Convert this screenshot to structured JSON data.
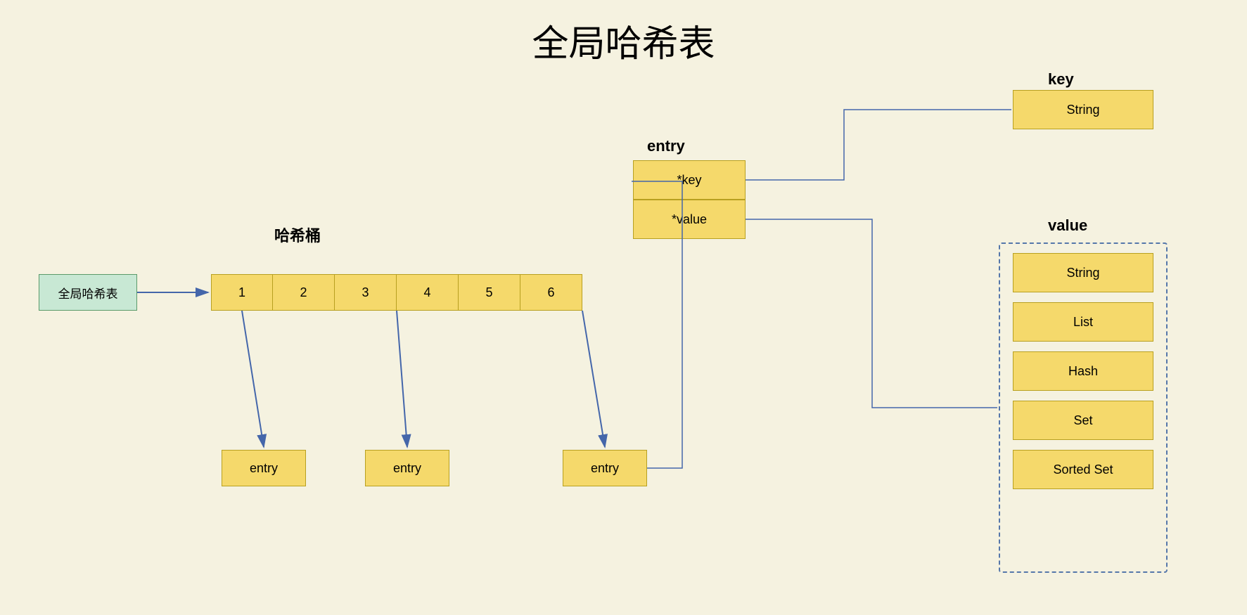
{
  "title": "全局哈希表",
  "global_hashtable_label": "全局哈希表",
  "hashtable_bucket_label": "哈希桶",
  "bucket_cells": [
    "1",
    "2",
    "3",
    "4",
    "5",
    "6"
  ],
  "entry_label": "entry",
  "entry_key_field": "*key",
  "entry_value_field": "*value",
  "key_label": "key",
  "key_type": "String",
  "value_label": "value",
  "value_types": [
    "String",
    "List",
    "Hash",
    "Set",
    "Sorted Set"
  ],
  "entry_boxes": [
    "entry",
    "entry",
    "entry"
  ]
}
